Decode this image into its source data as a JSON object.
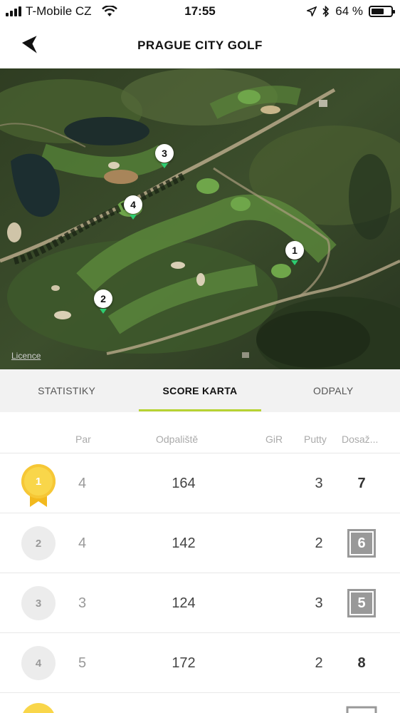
{
  "status": {
    "carrier": "T-Mobile CZ",
    "time": "17:55",
    "battery": "64 %",
    "battery_level": 0.64
  },
  "header": {
    "title": "PRAGUE CITY GOLF"
  },
  "map": {
    "licence": "Licence",
    "pins": [
      "1",
      "2",
      "3",
      "4"
    ]
  },
  "tabs": [
    {
      "label": "STATISTIKY"
    },
    {
      "label": "SCORE KARTA"
    },
    {
      "label": "ODPALY"
    }
  ],
  "table": {
    "headers": {
      "par": "Par",
      "tee": "Odpaliště",
      "gir": "GiR",
      "putts": "Putty",
      "score": "Dosaž..."
    },
    "rows": [
      {
        "hole": "1",
        "par": "4",
        "tee": "164",
        "putts": "3",
        "score": "7"
      },
      {
        "hole": "2",
        "par": "4",
        "tee": "142",
        "putts": "2",
        "score": "6"
      },
      {
        "hole": "3",
        "par": "3",
        "tee": "124",
        "putts": "3",
        "score": "5"
      },
      {
        "hole": "4",
        "par": "5",
        "tee": "172",
        "putts": "2",
        "score": "8"
      }
    ]
  },
  "colors": {
    "accent": "#b7d332",
    "medal": "#f9d64a",
    "pin_tip": "#2ecc71"
  }
}
